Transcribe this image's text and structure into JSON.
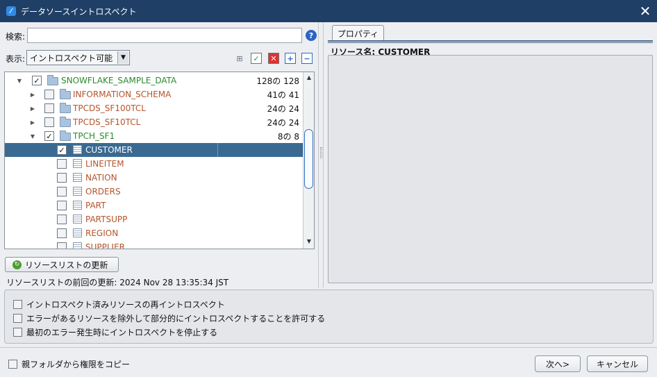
{
  "window": {
    "title": "データソースイントロスペクト",
    "close_glyph": "✕"
  },
  "left": {
    "search_label": "検索:",
    "search_value": "",
    "help_glyph": "?",
    "display_label": "表示:",
    "display_select": "イントロスペクト可能",
    "select_arrow": "▼"
  },
  "toolbar_icons": [
    "tree-structure-icon",
    "check-all-icon",
    "uncheck-all-icon",
    "expand-all-icon",
    "collapse-all-icon"
  ],
  "tree": {
    "root": {
      "name": "SNOWFLAKE_SAMPLE_DATA",
      "count": "128の 128",
      "checked": true,
      "expanded": true
    },
    "schemas": [
      {
        "name": "INFORMATION_SCHEMA",
        "count": "41の 41",
        "checked": false,
        "expanded": false
      },
      {
        "name": "TPCDS_SF100TCL",
        "count": "24の 24",
        "checked": false,
        "expanded": false
      },
      {
        "name": "TPCDS_SF10TCL",
        "count": "24の 24",
        "checked": false,
        "expanded": false
      },
      {
        "name": "TPCH_SF1",
        "count": "8の 8",
        "checked": true,
        "expanded": true
      }
    ],
    "tables": [
      {
        "name": "CUSTOMER",
        "checked": true,
        "selected": true
      },
      {
        "name": "LINEITEM",
        "checked": false
      },
      {
        "name": "NATION",
        "checked": false
      },
      {
        "name": "ORDERS",
        "checked": false
      },
      {
        "name": "PART",
        "checked": false
      },
      {
        "name": "PARTSUPP",
        "checked": false
      },
      {
        "name": "REGION",
        "checked": false
      },
      {
        "name": "SUPPLIER",
        "checked": false
      }
    ]
  },
  "refresh": {
    "button_label": "リソースリストの更新",
    "last_refresh": "リソースリストの前回の更新: 2024 Nov 28 13:35:34 JST"
  },
  "properties": {
    "tab_label": "プロパティ",
    "resource_name": "リソース名: CUSTOMER"
  },
  "options": [
    {
      "label": "イントロスペクト済みリソースの再イントロスペクト",
      "checked": false
    },
    {
      "label": "エラーがあるリソースを除外して部分的にイントロスペクトすることを許可する",
      "checked": false
    },
    {
      "label": "最初のエラー発生時にイントロスペクトを停止する",
      "checked": false
    }
  ],
  "footer": {
    "copy_permissions": "親フォルダから権限をコピー",
    "copy_permissions_checked": false,
    "next_label": "次へ>",
    "cancel_label": "キャンセル"
  },
  "colors": {
    "titlebar": "#1f3f66",
    "selection": "#3a6a92",
    "catalog_text": "#2d8a2d",
    "object_text": "#b5542a"
  }
}
